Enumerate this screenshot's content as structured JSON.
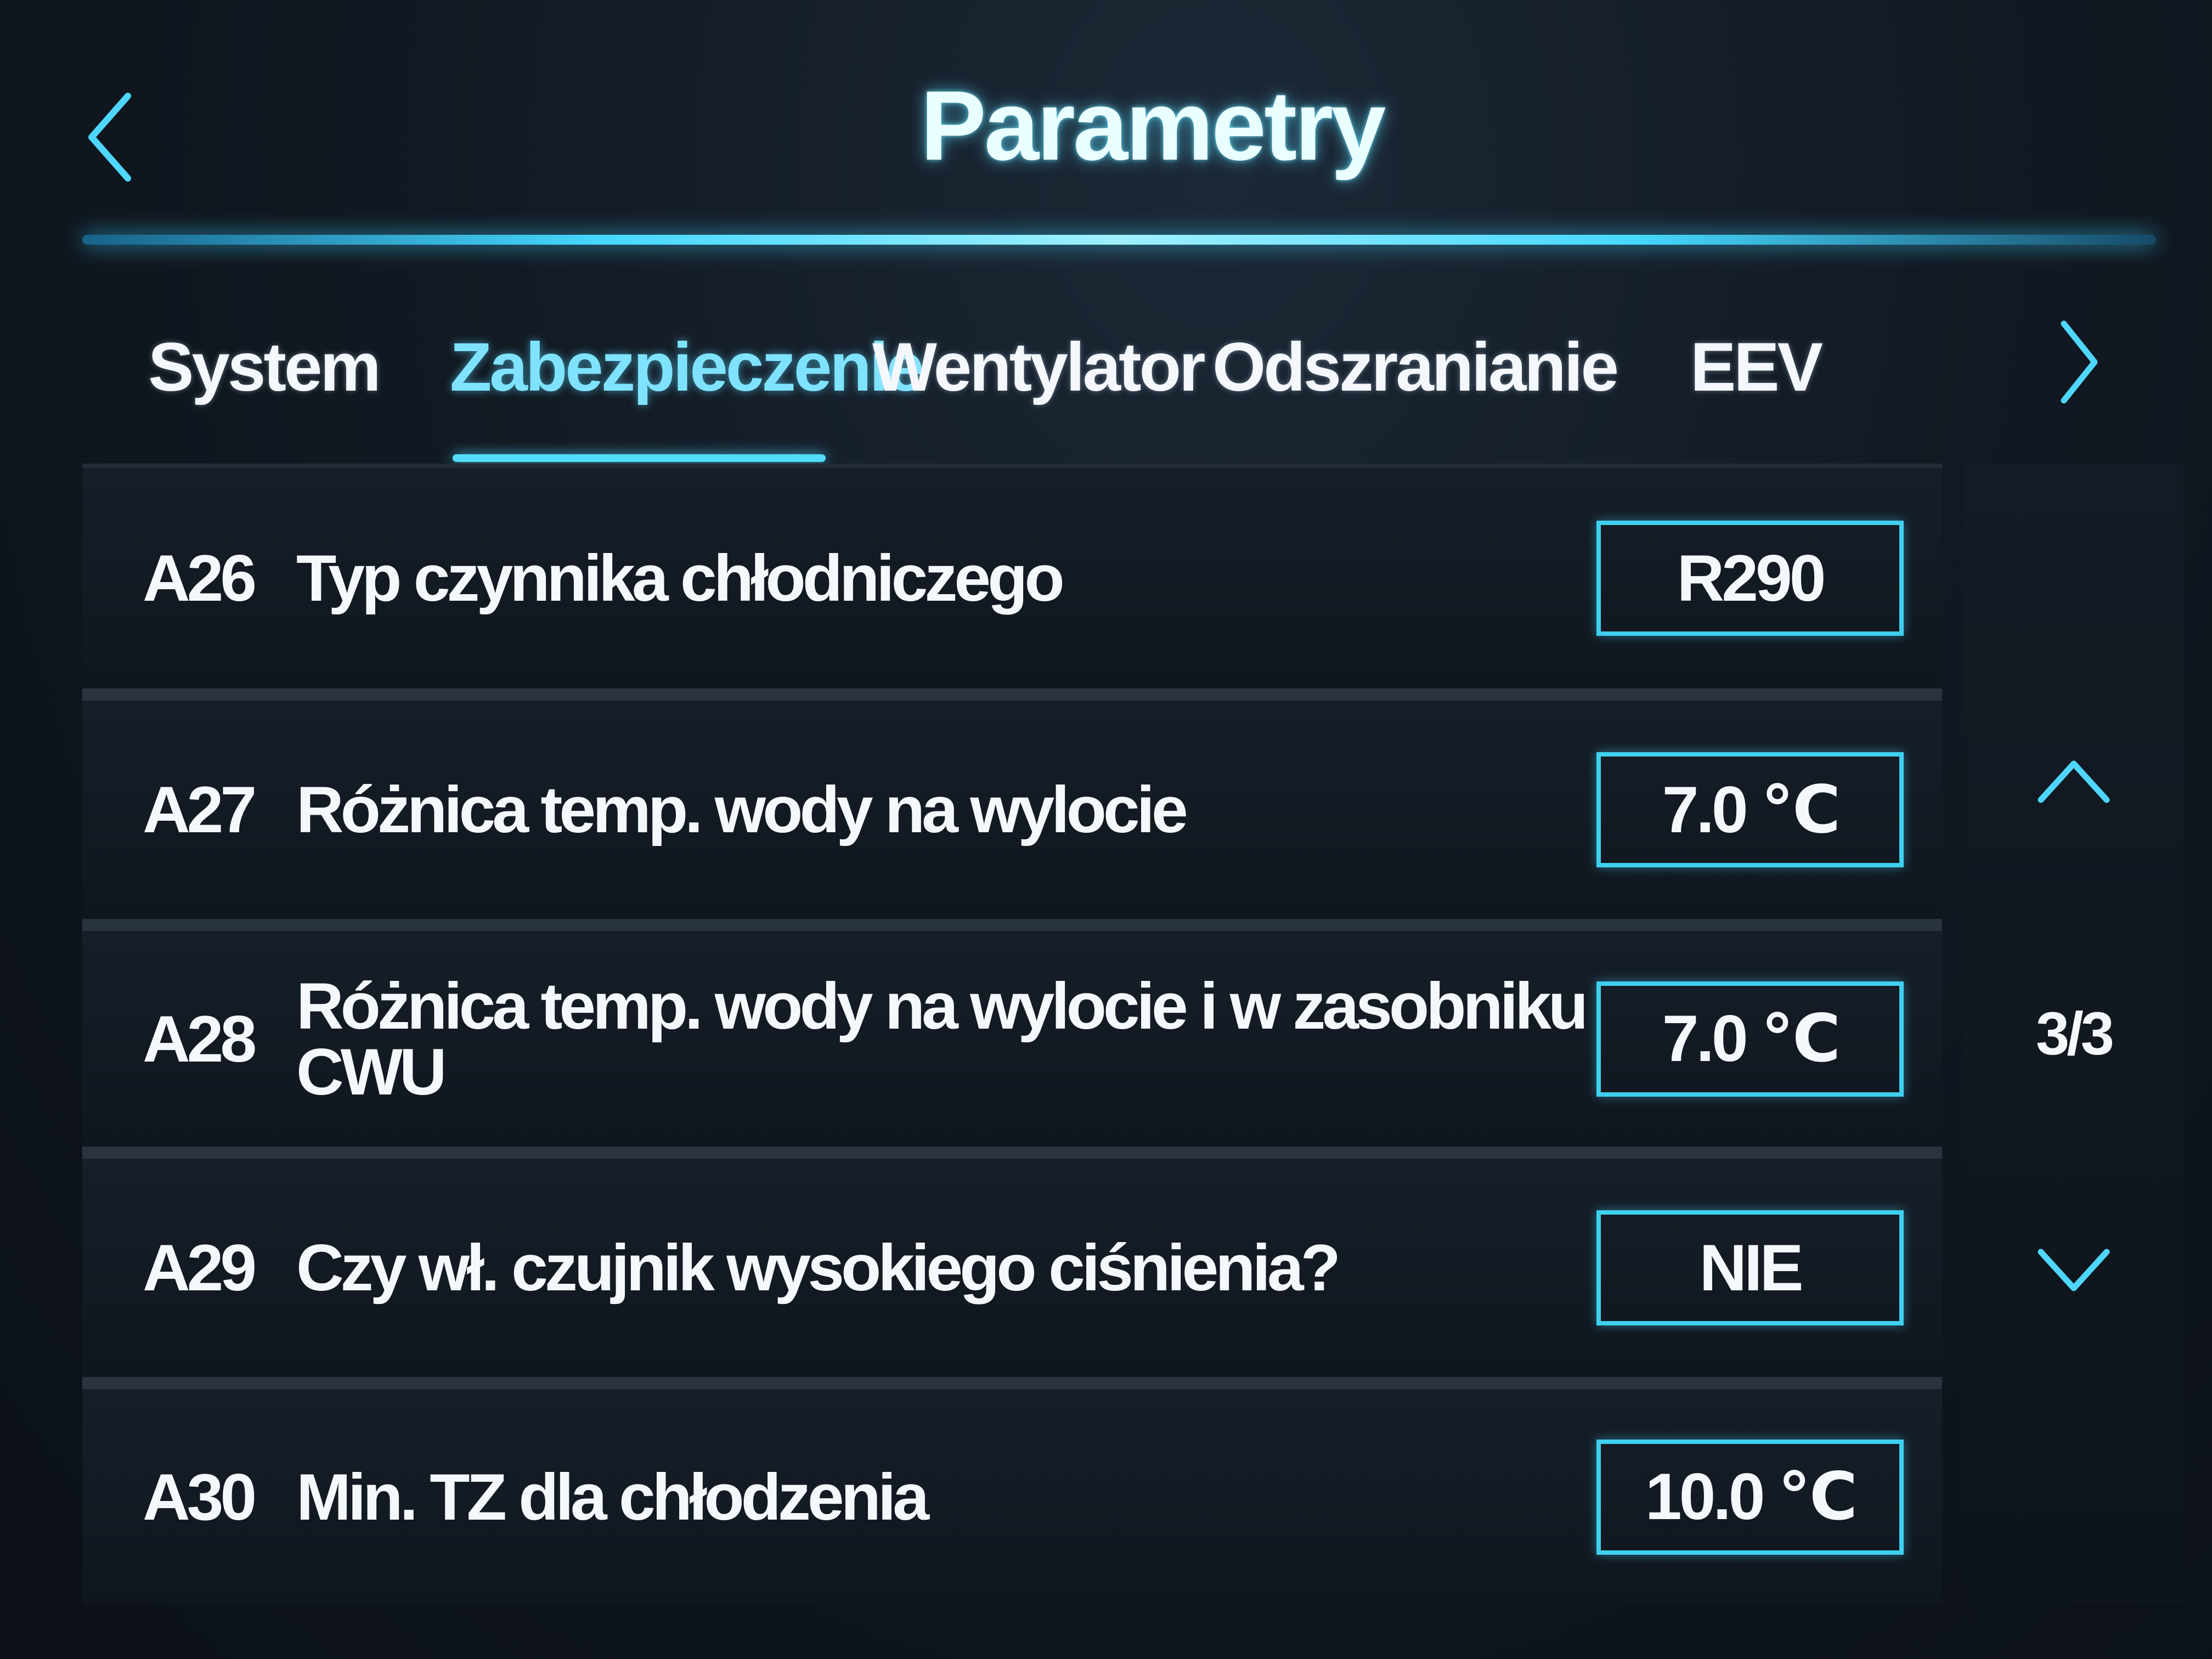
{
  "header": {
    "title": "Parametry",
    "back_icon": "chevron-left-icon"
  },
  "tabs": [
    {
      "label": "System",
      "active": false
    },
    {
      "label": "Zabezpieczenie",
      "active": true
    },
    {
      "label": "Wentylator",
      "active": false
    },
    {
      "label": "Odszranianie",
      "active": false
    },
    {
      "label": "EEV",
      "active": false
    }
  ],
  "next_tab_icon": "chevron-right-icon",
  "rows": [
    {
      "code": "A26",
      "label": "Typ czynnika chłodniczego",
      "value": "R290"
    },
    {
      "code": "A27",
      "label": "Różnica temp. wody na wylocie",
      "value": "7.0 ℃"
    },
    {
      "code": "A28",
      "label": "Różnica temp. wody na wylocie i w zasobniku CWU",
      "value": "7.0 ℃"
    },
    {
      "code": "A29",
      "label": "Czy wł. czujnik wysokiego ciśnienia?",
      "value": "NIE"
    },
    {
      "code": "A30",
      "label": "Min. TZ dla chłodzenia",
      "value": "10.0 ℃"
    }
  ],
  "pager": {
    "indicator": "3/3",
    "up_icon": "chevron-up-icon",
    "down_icon": "chevron-down-icon"
  },
  "colors": {
    "accent": "#53dcff",
    "background": "#121922",
    "text": "#f4f8fc"
  }
}
